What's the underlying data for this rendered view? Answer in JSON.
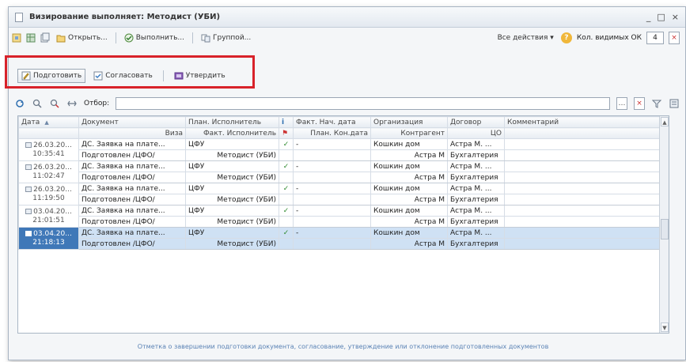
{
  "window": {
    "title": "Визирование выполняет: Методист (УБИ)",
    "controls": [
      "_",
      "□",
      "×"
    ]
  },
  "toolbar": {
    "open_label": "Открыть...",
    "execute_label": "Выполнить...",
    "group_label": "Группой...",
    "all_actions_label": "Все действия ▾",
    "visible_count_label": "Кол. видимых ОК",
    "visible_count_value": "4"
  },
  "actions": {
    "prepare_label": "Подготовить",
    "agree_label": "Согласовать",
    "approve_label": "Утвердить"
  },
  "filter": {
    "label": "Отбор:",
    "value": ""
  },
  "table": {
    "header1": [
      "Дата",
      "Документ",
      "План. Исполнитель",
      "",
      "Факт. Нач. дата",
      "Организация",
      "Договор",
      "Комментарий"
    ],
    "header2": [
      "",
      "Виза",
      "Факт. Исполнитель",
      "",
      "План. Кон.дата",
      "Контрагент",
      "ЦО",
      ""
    ],
    "rows": [
      {
        "date": "26.03.20...",
        "time": "10:35:41",
        "doc": "ДС. Заявка на плате...",
        "visa": "Подготовлен /ЦФО/",
        "plan": "ЦФУ",
        "fact": "Методист (УБИ)",
        "mark": "✓",
        "start": "-",
        "end": "",
        "org": "Кошкин дом",
        "contr": "Астра М",
        "dog": "Астра М. ...",
        "co": "Бухгалтерия",
        "comment": ""
      },
      {
        "date": "26.03.20...",
        "time": "11:02:47",
        "doc": "ДС. Заявка на плате...",
        "visa": "Подготовлен /ЦФО/",
        "plan": "ЦФУ",
        "fact": "Методист (УБИ)",
        "mark": "✓",
        "start": "-",
        "end": "",
        "org": "Кошкин дом",
        "contr": "Астра М",
        "dog": "Астра М. ...",
        "co": "Бухгалтерия",
        "comment": ""
      },
      {
        "date": "26.03.20...",
        "time": "11:19:50",
        "doc": "ДС. Заявка на плате...",
        "visa": "Подготовлен /ЦФО/",
        "plan": "ЦФУ",
        "fact": "Методист (УБИ)",
        "mark": "✓",
        "start": "-",
        "end": "",
        "org": "Кошкин дом",
        "contr": "Астра М",
        "dog": "Астра М. ...",
        "co": "Бухгалтерия",
        "comment": ""
      },
      {
        "date": "03.04.20...",
        "time": "21:01:51",
        "doc": "ДС. Заявка на плате...",
        "visa": "Подготовлен /ЦФО/",
        "plan": "ЦФУ",
        "fact": "Методист (УБИ)",
        "mark": "✓",
        "start": "-",
        "end": "",
        "org": "Кошкин дом",
        "contr": "Астра М",
        "dog": "Астра М. ...",
        "co": "Бухгалтерия",
        "comment": ""
      },
      {
        "date": "03.04.20...",
        "time": "21:18:13",
        "doc": "ДС. Заявка на плате...",
        "visa": "Подготовлен /ЦФО/",
        "plan": "ЦФУ",
        "fact": "Методист (УБИ)",
        "mark": "✓",
        "start": "-",
        "end": "",
        "org": "Кошкин дом",
        "contr": "Астра М",
        "dog": "Астра М. ...",
        "co": "Бухгалтерия",
        "comment": "",
        "selected": true
      }
    ]
  },
  "status": {
    "text": "Отметка о завершении подготовки документа, согласование, утверждение или отклонение подготовленных документов"
  }
}
